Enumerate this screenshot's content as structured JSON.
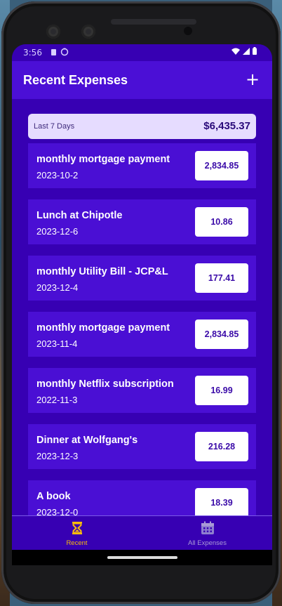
{
  "status": {
    "time": "3:56"
  },
  "appbar": {
    "title": "Recent Expenses",
    "add_label": "+"
  },
  "summary": {
    "period": "Last 7 Days",
    "total": "$6,435.37"
  },
  "expenses": [
    {
      "title": "monthly mortgage payment",
      "date": "2023-10-2",
      "amount": "2,834.85"
    },
    {
      "title": "Lunch at Chipotle",
      "date": "2023-12-6",
      "amount": "10.86"
    },
    {
      "title": "monthly Utility Bill - JCP&L",
      "date": "2023-12-4",
      "amount": "177.41"
    },
    {
      "title": "monthly mortgage payment",
      "date": "2023-11-4",
      "amount": "2,834.85"
    },
    {
      "title": "monthly Netflix subscription",
      "date": "2022-11-3",
      "amount": "16.99"
    },
    {
      "title": "Dinner at Wolfgang's",
      "date": "2023-12-3",
      "amount": "216.28"
    },
    {
      "title": "A book",
      "date": "2023-12-0",
      "amount": "18.39"
    }
  ],
  "bottom_nav": {
    "tabs": [
      {
        "label": "Recent",
        "icon": "hourglass-icon",
        "active": true
      },
      {
        "label": "All Expenses",
        "icon": "calendar-icon",
        "active": false
      }
    ]
  },
  "colors": {
    "primary": "#3700b3",
    "appbar": "#4b0fd6",
    "card": "#4a0fd4",
    "accent": "#f7bc0c",
    "summary_bg": "#e6dcff",
    "inactive": "#a99bd6"
  }
}
